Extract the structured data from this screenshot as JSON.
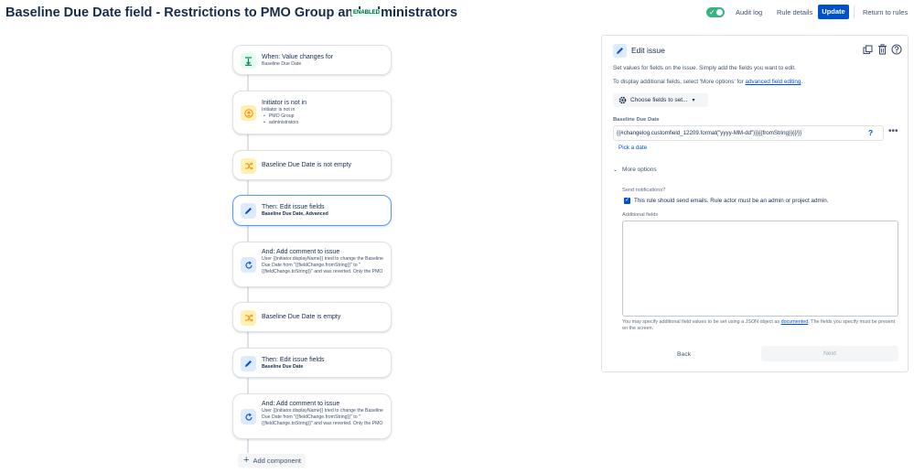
{
  "header": {
    "title": "Baseline Due Date field - Restrictions to PMO Group and administrators",
    "status_lozenge": "ENABLED",
    "audit_log": "Audit log",
    "rule_details": "Rule details",
    "update": "Update",
    "return_to_rules": "Return to rules"
  },
  "flow": {
    "cards": [
      {
        "title": "When: Value changes for",
        "subtitle": "Baseline Due Date",
        "icon": "trigger-icon"
      },
      {
        "title": "Initiator is not in",
        "subtitle": "Initiator is not in",
        "list": [
          "PMO Group",
          "administrators"
        ],
        "icon": "user-condition-icon"
      },
      {
        "title": "Baseline Due Date is not empty",
        "icon": "condition-icon"
      },
      {
        "title": "Then: Edit issue fields",
        "subtitle": "Baseline Due Date, Advanced",
        "icon": "pencil-icon"
      },
      {
        "title": "And: Add comment to issue",
        "subtitle": "User {{initiator.displayName}} tried to change the Baseline Due Date from \"{{fieldChange.fromString}}\" to \"{{fieldChange.toString}}\" and was reverted. Only the PMO",
        "icon": "comment-action-icon"
      },
      {
        "title": "Baseline Due Date is empty",
        "icon": "condition-icon"
      },
      {
        "title": "Then: Edit issue fields",
        "subtitle": "Baseline Due Date",
        "icon": "pencil-icon"
      },
      {
        "title": "And: Add comment to issue",
        "subtitle": "User {{initiator.displayName}} tried to change the Baseline Due Date from \"{{fieldChange.fromString}}\" to \"{{fieldChange.toString}}\" and was reverted. Only the PMO",
        "icon": "comment-action-icon"
      }
    ],
    "add_component": "Add component"
  },
  "panel": {
    "title": "Edit issue",
    "intro": "Set values for fields on the issue. Simply add the fields you want to edit.",
    "additional_prefix": "To display additional fields, select 'More options' for",
    "additional_link": "advanced field editing",
    "additional_suffix": ".",
    "choose_fields": "Choose fields to set...",
    "field_label": "Baseline Due Date",
    "field_value": "{{#changelog.customfield_12209.format(\"yyyy-MM-dd\")}}{{fromString}}{{/}}",
    "pick_date": "Pick a date",
    "more_options": "More options",
    "send_notifications_label": "Send notifications?",
    "send_notifications_text": "This rule should send emails. Rule actor must be an admin or project admin.",
    "send_notifications_checked": true,
    "additional_fields_label": "Additional fields",
    "additional_fields_value": "",
    "help_prefix": "You may specify additional field values to be set using a JSON object as",
    "help_link": "documented",
    "help_suffix": ". The fields you specify must be present on the screen.",
    "back": "Back",
    "next": "Next"
  },
  "colors": {
    "primary": "#0052cc",
    "enabled_toggle": "#36b37e",
    "selected_border": "#4c9aff"
  }
}
